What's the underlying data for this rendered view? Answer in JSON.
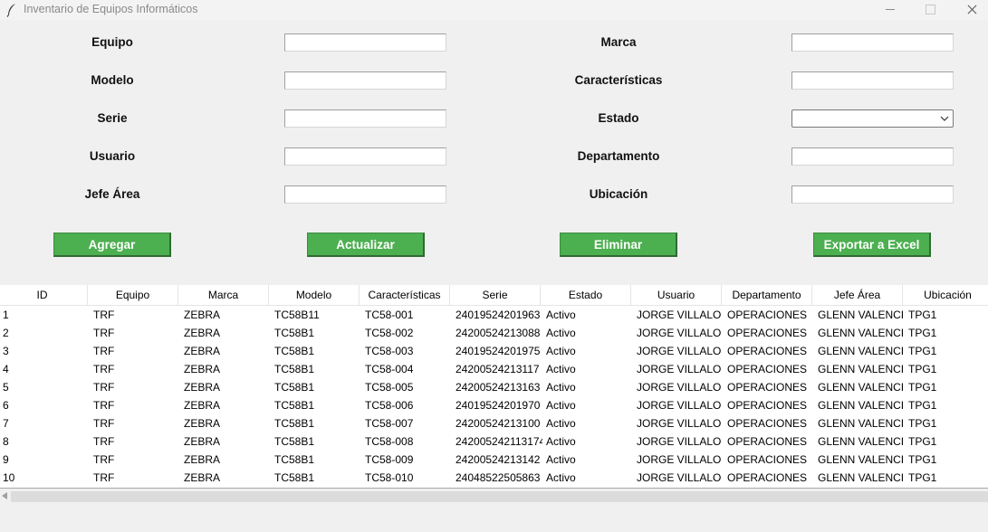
{
  "window": {
    "title": "Inventario de Equipos Informáticos"
  },
  "form": {
    "labels": {
      "equipo": "Equipo",
      "marca": "Marca",
      "modelo": "Modelo",
      "caracteristicas": "Características",
      "serie": "Serie",
      "estado": "Estado",
      "usuario": "Usuario",
      "departamento": "Departamento",
      "jefe_area": "Jefe Área",
      "ubicacion": "Ubicación"
    },
    "values": {
      "equipo": "",
      "marca": "",
      "modelo": "",
      "caracteristicas": "",
      "serie": "",
      "estado": "",
      "usuario": "",
      "departamento": "",
      "jefe_area": "",
      "ubicacion": ""
    }
  },
  "buttons": {
    "agregar": "Agregar",
    "actualizar": "Actualizar",
    "eliminar": "Eliminar",
    "exportar": "Exportar a Excel"
  },
  "colors": {
    "button_bg": "#4caf50",
    "button_text": "#ffffff"
  },
  "table": {
    "columns": [
      "ID",
      "Equipo",
      "Marca",
      "Modelo",
      "Características",
      "Serie",
      "Estado",
      "Usuario",
      "Departamento",
      "Jefe Área",
      "Ubicación"
    ],
    "rows": [
      [
        "1",
        "TRF",
        "ZEBRA",
        "TC58B11",
        "TC58-001",
        "24019524201963",
        "Activo",
        "JORGE VILLALOB(",
        "OPERACIONES",
        "GLENN VALENCI/",
        "TPG1"
      ],
      [
        "2",
        "TRF",
        "ZEBRA",
        "TC58B1",
        "TC58-002",
        "24200524213088",
        "Activo",
        "JORGE VILLALOB(",
        "OPERACIONES",
        "GLENN VALENCI/",
        "TPG1"
      ],
      [
        "3",
        "TRF",
        "ZEBRA",
        "TC58B1",
        "TC58-003",
        "24019524201975",
        "Activo",
        "JORGE VILLALOB(",
        "OPERACIONES",
        "GLENN VALENCI/",
        "TPG1"
      ],
      [
        "4",
        "TRF",
        "ZEBRA",
        "TC58B1",
        "TC58-004",
        "24200524213117",
        "Activo",
        "JORGE VILLALOB(",
        "OPERACIONES",
        "GLENN VALENCI/",
        "TPG1"
      ],
      [
        "5",
        "TRF",
        "ZEBRA",
        "TC58B1",
        "TC58-005",
        "24200524213163",
        "Activo",
        "JORGE VILLALOB(",
        "OPERACIONES",
        "GLENN VALENCI/",
        "TPG1"
      ],
      [
        "6",
        "TRF",
        "ZEBRA",
        "TC58B1",
        "TC58-006",
        "24019524201970",
        "Activo",
        "JORGE VILLALOB(",
        "OPERACIONES",
        "GLENN VALENCI/",
        "TPG1"
      ],
      [
        "7",
        "TRF",
        "ZEBRA",
        "TC58B1",
        "TC58-007",
        "24200524213100",
        "Activo",
        "JORGE VILLALOB(",
        "OPERACIONES",
        "GLENN VALENCI/",
        "TPG1"
      ],
      [
        "8",
        "TRF",
        "ZEBRA",
        "TC58B1",
        "TC58-008",
        "242005242113174",
        "Activo",
        "JORGE VILLALOB(",
        "OPERACIONES",
        "GLENN VALENCI/",
        "TPG1"
      ],
      [
        "9",
        "TRF",
        "ZEBRA",
        "TC58B1",
        "TC58-009",
        "24200524213142",
        "Activo",
        "JORGE VILLALOB(",
        "OPERACIONES",
        "GLENN VALENCI/",
        "TPG1"
      ],
      [
        "10",
        "TRF",
        "ZEBRA",
        "TC58B1",
        "TC58-010",
        "24048522505863",
        "Activo",
        "JORGE VILLALOB(",
        "OPERACIONES",
        "GLENN VALENCI/",
        "TPG1"
      ]
    ]
  }
}
